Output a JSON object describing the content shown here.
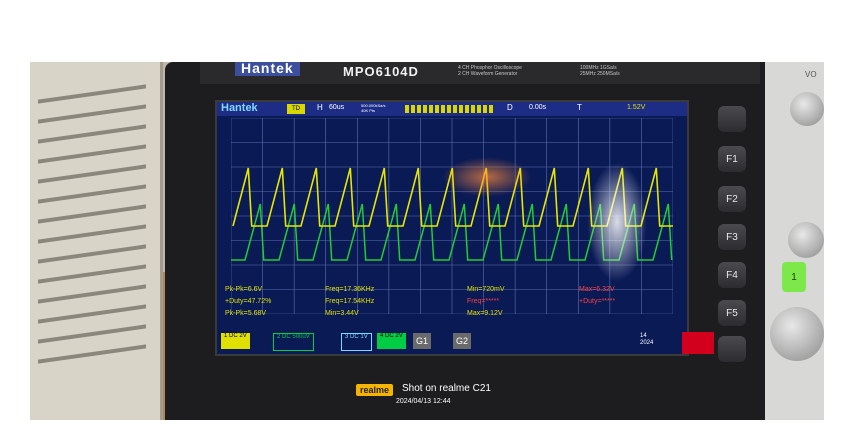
{
  "instrument": {
    "brand": "Hantek",
    "model": "MPO6104D",
    "spec_left": "4 CH Phosphor Oscilloscope\n2 CH Waveform Generator",
    "spec_right": "100MHz 1GSa/s\n25MHz 250MSa/s",
    "panel_label": "VO",
    "soft_buttons": [
      "",
      "F1",
      "F2",
      "F3",
      "F4",
      "F5",
      ""
    ],
    "knob_label": "1"
  },
  "screen": {
    "brand": "Hantek",
    "trigger_state": "TD",
    "h_label": "H",
    "h_value": "60us",
    "sample_rate": "500.000kSa/s\n40K Pts",
    "d_label": "D",
    "d_value": "0.00s",
    "t_label": "T",
    "t_value": "1.52V",
    "measurements": [
      {
        "text": "Pk-Pk=6.6V",
        "color": "#e0e000"
      },
      {
        "text": "Freq=17.36KHz",
        "color": "#e0e000"
      },
      {
        "text": "Min=720mV",
        "color": "#e0e000"
      },
      {
        "text": "Max=6.32V",
        "color": "#ff4040"
      },
      {
        "text": "+Duty=47.72%",
        "color": "#e0e000"
      },
      {
        "text": "Freq=17.54KHz",
        "color": "#e0e000"
      },
      {
        "text": "Freq=*****",
        "color": "#ff4040"
      },
      {
        "text": "+Duty=*****",
        "color": "#ff4040"
      },
      {
        "text": "Pk-Pk=5.68V",
        "color": "#e0e000"
      },
      {
        "text": "Min=3.44V",
        "color": "#e0e000"
      },
      {
        "text": "Max=9.12V",
        "color": "#e0e000"
      }
    ],
    "channels": [
      {
        "num": "1",
        "coupling": "DC",
        "scale": "2V",
        "color": "#e0e000"
      },
      {
        "num": "2",
        "coupling": "DC",
        "scale": "500uV",
        "color": "#00cc44"
      },
      {
        "num": "3",
        "coupling": "DC",
        "scale": "1V",
        "color": "#7ed7ff"
      },
      {
        "num": "4",
        "coupling": "DC",
        "scale": "2V",
        "color": "#00cc44"
      }
    ],
    "gen_labels": [
      "G1",
      "G2"
    ],
    "date_short": "14\n2024"
  },
  "waveforms": {
    "ch1_color": "#e6e600",
    "ch2_color": "#22cc33",
    "cycles": 13
  },
  "watermark": {
    "badge": "realme",
    "text": "Shot on realme C21",
    "datetime": "2024/04/13 12:44"
  }
}
